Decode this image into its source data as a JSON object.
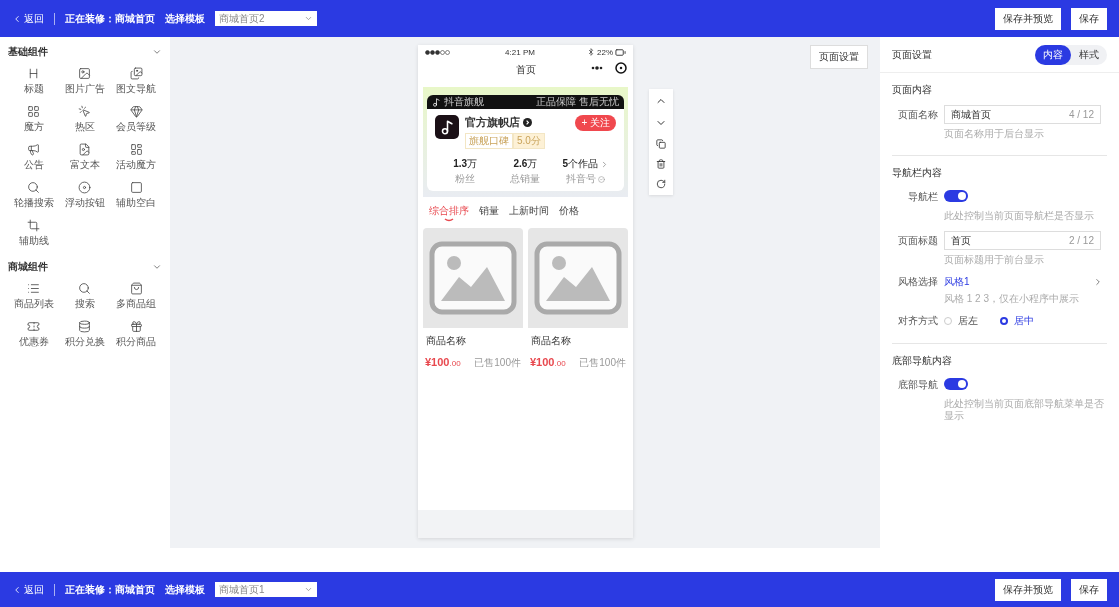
{
  "top_bar": {
    "back": "返回",
    "editing": "正在装修：商城首页",
    "template_label": "选择模板",
    "template_value": "商城首页2",
    "buttons": [
      "保存并预览",
      "保存"
    ]
  },
  "sidebar": {
    "groups": [
      {
        "title": "基础组件",
        "expanded": true,
        "items": [
          {
            "label": "标题"
          },
          {
            "label": "图片广告"
          },
          {
            "label": "图文导航"
          },
          {
            "label": "魔方"
          },
          {
            "label": "热区"
          },
          {
            "label": "会员等级"
          },
          {
            "label": "公告"
          },
          {
            "label": "富文本"
          },
          {
            "label": "活动魔方"
          },
          {
            "label": "轮播搜索"
          },
          {
            "label": "浮动按钮"
          },
          {
            "label": "辅助空白"
          },
          {
            "label": "辅助线"
          }
        ]
      },
      {
        "title": "商城组件",
        "expanded": true,
        "items": [
          {
            "label": "商品列表"
          },
          {
            "label": "搜索"
          },
          {
            "label": "多商品组"
          },
          {
            "label": "优惠券"
          },
          {
            "label": "积分兑换"
          },
          {
            "label": "积分商品"
          }
        ]
      }
    ]
  },
  "phone": {
    "time": "4:21 PM",
    "battery": "22%",
    "title": "首页",
    "store": {
      "badge": "抖音旗舰",
      "guarantee": "正品保障 售后无忧",
      "name": "官方旗帜店",
      "follow": "+ 关注",
      "rating_label": "旗舰口碑",
      "rating": "5.0分",
      "stats": [
        {
          "value": "1.3",
          "unit": "万",
          "label": "粉丝"
        },
        {
          "value": "2.6",
          "unit": "万",
          "label": "总销量"
        },
        {
          "value": "5",
          "unit": "个作品",
          "label": "抖音号"
        }
      ]
    },
    "sort_tabs": [
      {
        "label": "综合排序",
        "selected": true
      },
      {
        "label": "销量",
        "selected": false
      },
      {
        "label": "上新时间",
        "selected": false
      },
      {
        "label": "价格",
        "selected": false
      }
    ],
    "products": [
      {
        "name": "商品名称",
        "price": "¥100",
        "decimals": ".00",
        "sold": "已售100件"
      },
      {
        "name": "商品名称",
        "price": "¥100",
        "decimals": ".00",
        "sold": "已售100件"
      }
    ]
  },
  "settings_button": "页面设置",
  "panel": {
    "title": "页面设置",
    "tabs": [
      {
        "label": "内容",
        "selected": true
      },
      {
        "label": "样式",
        "selected": false
      }
    ],
    "sections": [
      {
        "title": "页面内容",
        "rows": [
          {
            "kind": "input",
            "label": "页面名称",
            "value": "商城首页",
            "count": "4 / 12",
            "hint": "页面名称用于后台显示"
          }
        ]
      },
      {
        "title": "导航栏内容",
        "rows": [
          {
            "kind": "switch",
            "label": "导航栏",
            "on": true,
            "hint": "此处控制当前页面导航栏是否显示"
          },
          {
            "kind": "input",
            "label": "页面标题",
            "value": "首页",
            "count": "2 / 12",
            "hint": "页面标题用于前台显示"
          },
          {
            "kind": "link",
            "label": "风格选择",
            "value": "风格1",
            "hint": "风格 1 2 3，仅在小程序中展示"
          },
          {
            "kind": "radio",
            "label": "对齐方式",
            "options": [
              {
                "label": "居左",
                "selected": false
              },
              {
                "label": "居中",
                "selected": true
              }
            ]
          }
        ]
      },
      {
        "title": "底部导航内容",
        "rows": [
          {
            "kind": "switch",
            "label": "底部导航",
            "on": true,
            "hint": "此处控制当前页面底部导航菜单是否显示"
          }
        ]
      }
    ]
  },
  "bottom_bar": {
    "back": "返回",
    "editing": "正在装修：商城首页",
    "template_label": "选择模板",
    "template_value": "商城首页1",
    "buttons": [
      "保存并预览",
      "保存"
    ]
  }
}
